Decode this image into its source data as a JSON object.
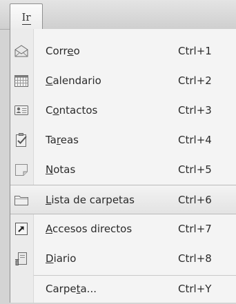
{
  "menu": {
    "title": "Ir",
    "items": [
      {
        "label_before": "Corr",
        "label_mnemonic": "e",
        "label_after": "o",
        "shortcut": "Ctrl+1",
        "icon": "mail-icon"
      },
      {
        "label_before": "",
        "label_mnemonic": "C",
        "label_after": "alendario",
        "shortcut": "Ctrl+2",
        "icon": "calendar-icon"
      },
      {
        "label_before": "C",
        "label_mnemonic": "o",
        "label_after": "ntactos",
        "shortcut": "Ctrl+3",
        "icon": "contacts-icon"
      },
      {
        "label_before": "Ta",
        "label_mnemonic": "r",
        "label_after": "eas",
        "shortcut": "Ctrl+4",
        "icon": "tasks-icon"
      },
      {
        "label_before": "",
        "label_mnemonic": "N",
        "label_after": "otas",
        "shortcut": "Ctrl+5",
        "icon": "notes-icon"
      },
      {
        "label_before": "",
        "label_mnemonic": "L",
        "label_after": "ista de carpetas",
        "shortcut": "Ctrl+6",
        "icon": "folder-list-icon",
        "highlighted": true
      },
      {
        "label_before": "",
        "label_mnemonic": "A",
        "label_after": "ccesos directos",
        "shortcut": "Ctrl+7",
        "icon": "shortcut-icon"
      },
      {
        "label_before": "",
        "label_mnemonic": "D",
        "label_after": "iario",
        "shortcut": "Ctrl+8",
        "icon": "journal-icon"
      },
      {
        "label_before": "Carpe",
        "label_mnemonic": "t",
        "label_after": "a...",
        "shortcut": "Ctrl+Y",
        "icon": ""
      }
    ]
  }
}
